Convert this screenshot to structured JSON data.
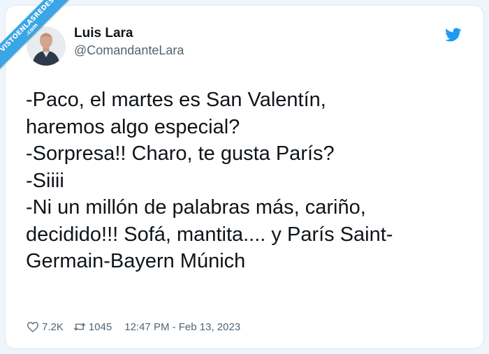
{
  "watermark": {
    "line1": "VISTOENLASREDES",
    "line2": ".com"
  },
  "author": {
    "name": "Luis Lara",
    "handle": "@ComandanteLara"
  },
  "tweet": {
    "lines": [
      "-Paco, el martes es San Valentín,",
      "haremos algo especial?",
      "-Sorpresa!! Charo, te gusta París?",
      "-Siiii",
      "-Ni un millón de palabras más, cariño,",
      "decidido!!! Sofá, mantita.... y París Saint-",
      "Germain-Bayern Múnich"
    ]
  },
  "footer": {
    "likes": "7.2K",
    "retweets": "1045",
    "timestamp": "12:47 PM - Feb 13, 2023"
  },
  "colors": {
    "twitter_blue": "#1d9bf0",
    "ribbon_blue": "#3aa6e6",
    "text": "#0f1419",
    "secondary": "#536471"
  },
  "icons": {
    "brand": "twitter-bird-icon",
    "like": "heart-icon",
    "retweet": "retweet-icon"
  }
}
